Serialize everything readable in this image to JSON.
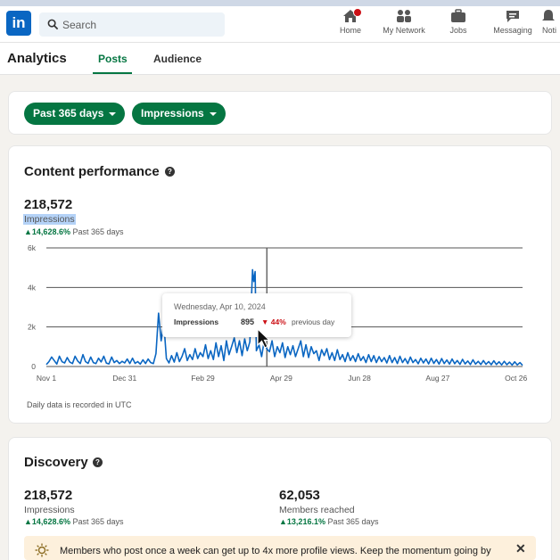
{
  "nav": {
    "logo": "in",
    "search_placeholder": "Search",
    "items": [
      {
        "label": "Home",
        "icon": "home-icon"
      },
      {
        "label": "My Network",
        "icon": "network-icon"
      },
      {
        "label": "Jobs",
        "icon": "briefcase-icon"
      },
      {
        "label": "Messaging",
        "icon": "chat-icon"
      },
      {
        "label": "Noti",
        "icon": "bell-icon"
      }
    ]
  },
  "subnav": {
    "title": "Analytics",
    "tabs": [
      "Posts",
      "Audience"
    ],
    "active_tab": "Posts"
  },
  "filters": {
    "range_label": "Past 365 days",
    "metric_label": "Impressions"
  },
  "content_performance": {
    "title": "Content performance",
    "help": "?",
    "total": "218,572",
    "metric": "Impressions",
    "change": "14,628.6%",
    "change_suffix": "Past 365 days",
    "note": "Daily data is recorded in UTC"
  },
  "tooltip": {
    "date": "Wednesday, Apr 10, 2024",
    "label": "Impressions",
    "value": "895",
    "change": "44%",
    "change_suffix": "previous day"
  },
  "discovery": {
    "title": "Discovery",
    "help": "?",
    "metrics": [
      {
        "value": "218,572",
        "label": "Impressions",
        "change": "14,628.6%",
        "suffix": "Past 365 days"
      },
      {
        "value": "62,053",
        "label": "Members reached",
        "change": "13,216.1%",
        "suffix": "Past 365 days"
      }
    ]
  },
  "banner": {
    "text": "Members who post once a week can get up to 4x more profile views. Keep the momentum going by",
    "close": "✕"
  },
  "colors": {
    "accent": "#057642",
    "line": "#0a66c2",
    "negative": "#cc1016",
    "highlight": "#b4d2f7"
  },
  "chart_data": {
    "type": "line",
    "ylim": [
      0,
      6000
    ],
    "y_ticks": [
      0,
      2000,
      4000,
      6000
    ],
    "y_tick_labels": [
      "0",
      "2k",
      "4k",
      "6k"
    ],
    "x_tick_labels": [
      "Nov 1",
      "Dec 31",
      "Feb 29",
      "Apr 29",
      "Jun 28",
      "Aug 27",
      "Oct 26"
    ],
    "x_tick_days": [
      0,
      60,
      120,
      180,
      240,
      300,
      360
    ],
    "x_range_days": [
      0,
      365
    ],
    "grid": true,
    "series": [
      {
        "points": [
          [
            0,
            100
          ],
          [
            2,
            250
          ],
          [
            4,
            480
          ],
          [
            6,
            300
          ],
          [
            8,
            120
          ],
          [
            10,
            520
          ],
          [
            12,
            240
          ],
          [
            14,
            180
          ],
          [
            16,
            450
          ],
          [
            18,
            220
          ],
          [
            20,
            150
          ],
          [
            22,
            520
          ],
          [
            24,
            280
          ],
          [
            26,
            150
          ],
          [
            28,
            600
          ],
          [
            30,
            250
          ],
          [
            32,
            160
          ],
          [
            34,
            480
          ],
          [
            36,
            200
          ],
          [
            38,
            150
          ],
          [
            40,
            420
          ],
          [
            42,
            230
          ],
          [
            44,
            520
          ],
          [
            46,
            170
          ],
          [
            48,
            130
          ],
          [
            50,
            480
          ],
          [
            52,
            200
          ],
          [
            54,
            300
          ],
          [
            56,
            150
          ],
          [
            58,
            260
          ],
          [
            60,
            180
          ],
          [
            62,
            380
          ],
          [
            64,
            150
          ],
          [
            66,
            420
          ],
          [
            68,
            160
          ],
          [
            70,
            250
          ],
          [
            72,
            120
          ],
          [
            74,
            340
          ],
          [
            76,
            150
          ],
          [
            78,
            380
          ],
          [
            80,
            200
          ],
          [
            82,
            150
          ],
          [
            84,
            650
          ],
          [
            86,
            2700
          ],
          [
            88,
            1300
          ],
          [
            90,
            2200
          ],
          [
            92,
            400
          ],
          [
            94,
            180
          ],
          [
            96,
            550
          ],
          [
            98,
            220
          ],
          [
            100,
            700
          ],
          [
            102,
            250
          ],
          [
            104,
            520
          ],
          [
            106,
            900
          ],
          [
            108,
            300
          ],
          [
            110,
            600
          ],
          [
            112,
            350
          ],
          [
            114,
            900
          ],
          [
            116,
            400
          ],
          [
            118,
            700
          ],
          [
            120,
            500
          ],
          [
            122,
            1100
          ],
          [
            124,
            400
          ],
          [
            126,
            800
          ],
          [
            128,
            350
          ],
          [
            130,
            1200
          ],
          [
            132,
            500
          ],
          [
            134,
            1050
          ],
          [
            136,
            300
          ],
          [
            138,
            1300
          ],
          [
            140,
            600
          ],
          [
            142,
            1000
          ],
          [
            144,
            1450
          ],
          [
            146,
            700
          ],
          [
            148,
            1300
          ],
          [
            150,
            550
          ],
          [
            152,
            1400
          ],
          [
            154,
            800
          ],
          [
            156,
            1250
          ],
          [
            158,
            4900
          ],
          [
            159,
            4300
          ],
          [
            160,
            4800
          ],
          [
            161,
            800
          ],
          [
            163,
            1100
          ],
          [
            165,
            500
          ],
          [
            167,
            1300
          ],
          [
            169,
            895
          ],
          [
            171,
            750
          ],
          [
            173,
            1300
          ],
          [
            175,
            500
          ],
          [
            177,
            1000
          ],
          [
            179,
            700
          ],
          [
            181,
            1200
          ],
          [
            183,
            450
          ],
          [
            185,
            1000
          ],
          [
            187,
            600
          ],
          [
            189,
            1050
          ],
          [
            191,
            500
          ],
          [
            193,
            900
          ],
          [
            195,
            1300
          ],
          [
            197,
            500
          ],
          [
            199,
            1100
          ],
          [
            201,
            450
          ],
          [
            203,
            1000
          ],
          [
            205,
            650
          ],
          [
            207,
            800
          ],
          [
            209,
            300
          ],
          [
            211,
            850
          ],
          [
            213,
            550
          ],
          [
            215,
            900
          ],
          [
            217,
            350
          ],
          [
            219,
            700
          ],
          [
            221,
            300
          ],
          [
            223,
            850
          ],
          [
            225,
            350
          ],
          [
            227,
            600
          ],
          [
            229,
            250
          ],
          [
            231,
            700
          ],
          [
            233,
            300
          ],
          [
            235,
            550
          ],
          [
            237,
            250
          ],
          [
            239,
            650
          ],
          [
            241,
            300
          ],
          [
            243,
            500
          ],
          [
            245,
            200
          ],
          [
            247,
            600
          ],
          [
            249,
            250
          ],
          [
            251,
            550
          ],
          [
            253,
            200
          ],
          [
            255,
            500
          ],
          [
            257,
            250
          ],
          [
            259,
            450
          ],
          [
            261,
            180
          ],
          [
            263,
            550
          ],
          [
            265,
            200
          ],
          [
            267,
            450
          ],
          [
            269,
            150
          ],
          [
            271,
            520
          ],
          [
            273,
            200
          ],
          [
            275,
            400
          ],
          [
            277,
            150
          ],
          [
            279,
            480
          ],
          [
            281,
            200
          ],
          [
            283,
            350
          ],
          [
            285,
            140
          ],
          [
            287,
            420
          ],
          [
            289,
            180
          ],
          [
            291,
            380
          ],
          [
            293,
            130
          ],
          [
            295,
            420
          ],
          [
            297,
            160
          ],
          [
            299,
            350
          ],
          [
            301,
            120
          ],
          [
            303,
            400
          ],
          [
            305,
            150
          ],
          [
            307,
            330
          ],
          [
            309,
            120
          ],
          [
            311,
            380
          ],
          [
            313,
            140
          ],
          [
            315,
            300
          ],
          [
            317,
            110
          ],
          [
            319,
            360
          ],
          [
            321,
            130
          ],
          [
            323,
            280
          ],
          [
            325,
            100
          ],
          [
            327,
            340
          ],
          [
            329,
            120
          ],
          [
            331,
            260
          ],
          [
            333,
            100
          ],
          [
            335,
            300
          ],
          [
            337,
            110
          ],
          [
            339,
            250
          ],
          [
            341,
            90
          ],
          [
            343,
            290
          ],
          [
            345,
            100
          ],
          [
            347,
            240
          ],
          [
            349,
            80
          ],
          [
            351,
            260
          ],
          [
            353,
            90
          ],
          [
            355,
            220
          ],
          [
            357,
            70
          ],
          [
            359,
            240
          ],
          [
            361,
            80
          ],
          [
            363,
            200
          ],
          [
            365,
            60
          ]
        ]
      }
    ],
    "hover_marker_day": 169
  }
}
